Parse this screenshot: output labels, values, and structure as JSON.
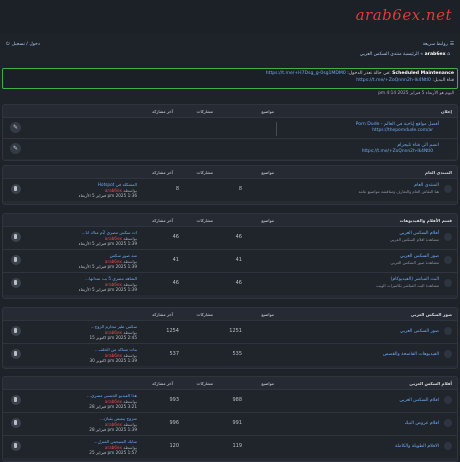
{
  "logo": {
    "text": "arab",
    "num": "6",
    "rest": "ex.net"
  },
  "nav": {
    "quick_links": "روابط سريعة",
    "login": "دخول / تسجيل"
  },
  "breadcrumb": {
    "home": "arab6ex",
    "rest": "» الرئيسية منتدى السكس العربي"
  },
  "notice": {
    "title": "Scheduled Maintenance",
    "label": "في حالة تعذر الدخول:",
    "link1": "https://t.me/+H7Dsg_g-0sg1MDM0",
    "label2": "قناة البديل:",
    "link2": "https://t.me/+ZoQnnn2h-Ik4Ntl0"
  },
  "time": "اليوم هو الأربعاء 5 فبراير 2025 4:14 pm",
  "headers": {
    "topics": "مواضيع",
    "posts": "مشاركات",
    "last": "آخر مشاركة"
  },
  "ads": {
    "title": "إعلان",
    "rows": [
      {
        "name": "أفضل مواقع إباحية في العالم - Porn Dude",
        "link": "https://theporndude.com/ar"
      },
      {
        "name": "انضم الى قناة تليجرام",
        "link": "https://t.me/+ZoQnnn2h-Ik4Ntl0"
      }
    ]
  },
  "b1": {
    "title": "المنتدى العام",
    "rows": [
      {
        "name": "المنتدى العام",
        "desc": "هنا النقاش العام والتعارف ومناقشة مواضيع عامة",
        "topics": "8",
        "posts": "8",
        "lt": "المشكلة في Hotspot",
        "by": "arab6ex",
        "dt": "1:36 pm 2025 فبراير 5 الأربعاء"
      }
    ]
  },
  "b2": {
    "title": "قسم الأفلام والفيديوهات",
    "rows": [
      {
        "name": "أفلام السكس العربي",
        "desc": "مشاهدة افلام السكس العربي",
        "topics": "46",
        "posts": "46",
        "lt": "ات سكس مصري 2م مناك انا...",
        "by": "arab6ex",
        "dt": "1:39 pm 2025 فبراير 5 الأربعاء"
      },
      {
        "name": "صور السكس العربي",
        "desc": "مشاهدة صور السكس العربي",
        "topics": "41",
        "posts": "41",
        "lt": "منه صور سكس",
        "by": "arab6ex",
        "dt": "1:39 pm 2025 فبراير 5 الأربعاء"
      },
      {
        "name": "البث المباشر (الفيديوكام)",
        "desc": "مشاهدة البث المباشر بكاميرات الويب",
        "topics": "46",
        "posts": "46",
        "lt": "الشاهد مصري 5 بث تمداتها...",
        "by": "arab6ex",
        "dt": "1:39 pm 2025 فبراير 5 الأربعاء"
      }
    ]
  },
  "b3": {
    "title": "صور السكس العربي",
    "rows": [
      {
        "name": "صور السكس العربي",
        "desc": "",
        "topics": "1251",
        "posts": "1254",
        "lt": "سكس طيز محارم الزوج...",
        "by": "arab6ex",
        "dt": "2:45 pm 2025 اكتوبر 15"
      },
      {
        "name": "الفيديوهات الفاضحة والقصص",
        "desc": "",
        "topics": "535",
        "posts": "537",
        "lt": "بنات متناكه من الخلف...",
        "by": "arab6ex",
        "dt": "1:39 pm 2025 اكتوبر 30"
      }
    ]
  },
  "b4": {
    "title": "أفلام السكس العربي",
    "rows": [
      {
        "name": "افلام السكس العربي",
        "desc": "",
        "topics": "988",
        "posts": "993",
        "lt": "هذا الفيديو الجنسي مصري...",
        "by": "arab6ex",
        "dt": "3:21 pm 2025 فبراير 28"
      },
      {
        "name": "افلام عروض النيك",
        "desc": "",
        "topics": "991",
        "posts": "996",
        "lt": "متزوج يبعبص بقبان...",
        "by": "arab6ex",
        "dt": "1:39 pm 2025 فبراير 28"
      },
      {
        "name": "الافلام الطويلة والكاملة",
        "desc": "",
        "topics": "119",
        "posts": "120",
        "lt": "منايك السيجمن المنزل...",
        "by": "arab6ex",
        "dt": "1:57 pm 2025 فبراير 25"
      }
    ]
  },
  "labels": {
    "by": "بواسطة"
  }
}
